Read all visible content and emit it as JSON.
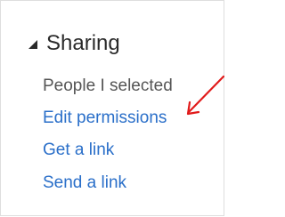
{
  "sharing": {
    "header": {
      "title": "Sharing",
      "icon": "collapse-triangle-icon"
    },
    "status_text": "People I selected",
    "links": [
      "Edit permissions",
      "Get a link",
      "Send a link"
    ]
  },
  "annotation": {
    "icon": "red-arrow-icon",
    "color": "#e11b1b"
  },
  "colors": {
    "link": "#2a6fc9",
    "status_text": "#555555",
    "title": "#2a2a2a"
  }
}
